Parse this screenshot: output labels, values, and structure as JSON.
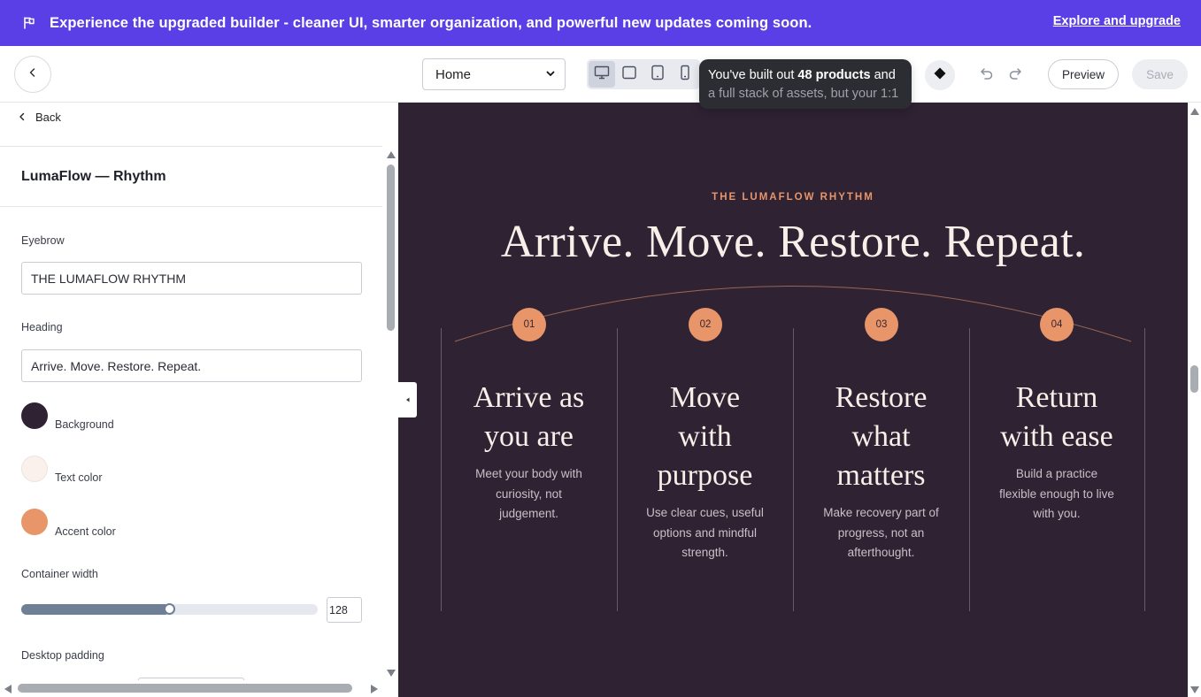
{
  "banner": {
    "icon": "flag-icon",
    "message": "Experience the upgraded builder - cleaner UI, smarter organization, and powerful new updates coming soon.",
    "cta": "Explore and upgrade",
    "color": "#5b3fe6"
  },
  "toolbar": {
    "back_icon": "chevron-left-icon",
    "page_select": {
      "value": "Home"
    },
    "devices": [
      "desktop-icon",
      "tablet-landscape-icon",
      "tablet-icon",
      "mobile-icon"
    ],
    "active_device": "desktop",
    "tooltip": {
      "prefix": "You've built out ",
      "bold": "48 products",
      "suffix": " and",
      "line2": "a full stack of assets, but your 1:1"
    },
    "diamond_icon": "diamond-icon",
    "undo_icon": "undo-icon",
    "redo_icon": "redo-icon",
    "preview_label": "Preview",
    "save_label": "Save"
  },
  "panel": {
    "back_label": "Back",
    "section_title": "LumaFlow — Rhythm",
    "eyebrow": {
      "label": "Eyebrow",
      "value": "THE LUMAFLOW RHYTHM"
    },
    "heading": {
      "label": "Heading",
      "value": "Arrive. Move. Restore. Repeat."
    },
    "colors": [
      {
        "label": "Background",
        "hex": "#2e2233"
      },
      {
        "label": "Text color",
        "hex": "#faf1ec"
      },
      {
        "label": "Accent color",
        "hex": "#e8956a"
      }
    ],
    "container_width": {
      "label": "Container width",
      "value": "128",
      "fill_fraction": 0.5
    },
    "desktop_padding": {
      "label": "Desktop padding"
    }
  },
  "canvas": {
    "eyebrow": "THE LUMAFLOW RHYTHM",
    "heading": "Arrive. Move. Restore. Repeat.",
    "steps": [
      {
        "num": "01",
        "title_lines": [
          "Arrive as",
          "you are"
        ],
        "body_lines": [
          "Meet your body with",
          "curiosity, not",
          "judgement."
        ]
      },
      {
        "num": "02",
        "title_lines": [
          "Move",
          "with",
          "purpose"
        ],
        "body_lines": [
          "Use clear cues, useful",
          "options and mindful",
          "strength."
        ]
      },
      {
        "num": "03",
        "title_lines": [
          "Restore",
          "what",
          "matters"
        ],
        "body_lines": [
          "Make recovery part of",
          "progress, not an",
          "afterthought."
        ]
      },
      {
        "num": "04",
        "title_lines": [
          "Return",
          "with ease"
        ],
        "body_lines": [
          "Build a practice",
          "flexible enough to live",
          "with you."
        ]
      }
    ]
  }
}
